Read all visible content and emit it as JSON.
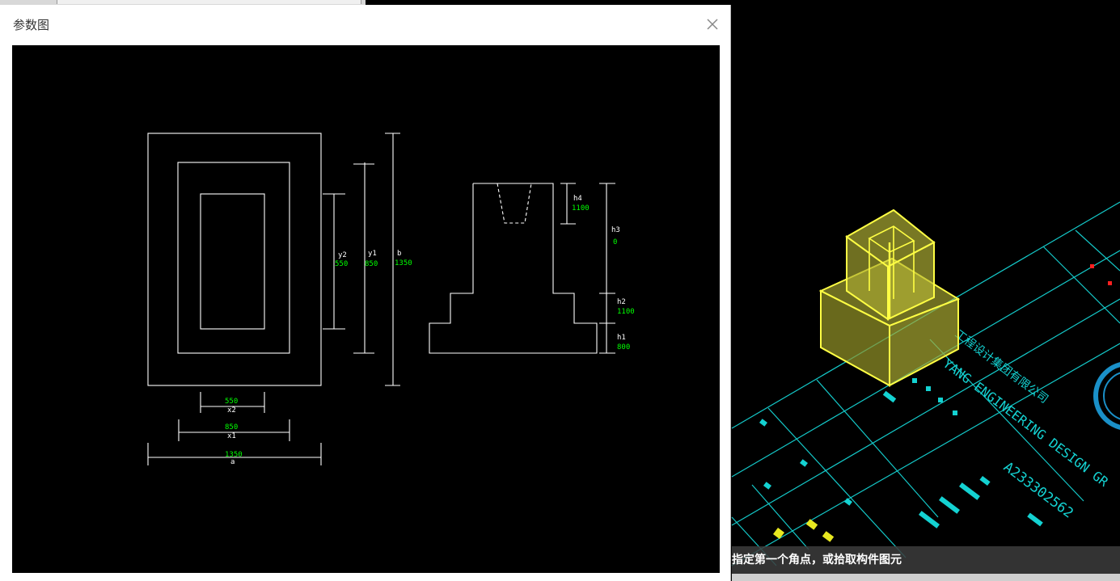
{
  "dialog": {
    "title": "参数图",
    "close_glyph": "✕"
  },
  "diagram": {
    "plan": {
      "y2": {
        "label": "y2",
        "value": "550"
      },
      "y1": {
        "label": "y1",
        "value": "850"
      },
      "b": {
        "label": "b",
        "value": "1350"
      },
      "x2": {
        "label": "x2",
        "value": "550"
      },
      "x1": {
        "label": "x1",
        "value": "850"
      },
      "a": {
        "label": "a",
        "value": "1350"
      }
    },
    "section": {
      "h4": {
        "label": "h4",
        "value": "1100"
      },
      "h3": {
        "label": "h3",
        "value": "0"
      },
      "h2": {
        "label": "h2",
        "value": "1100"
      },
      "h1": {
        "label": "h1",
        "value": "800"
      }
    }
  },
  "viewport": {
    "command_prompt": "指定第一个角点，或拾取构件图元",
    "title_block": {
      "company_en": "YANG ENGINEERING DESIGN GR",
      "company_cn": "工程设计集团有限公司",
      "code": "A233302562"
    },
    "colors": {
      "background": "#000000",
      "grid_lines": "#00cccc",
      "model": "#ffff44",
      "dim_text": "#00ff00"
    }
  }
}
